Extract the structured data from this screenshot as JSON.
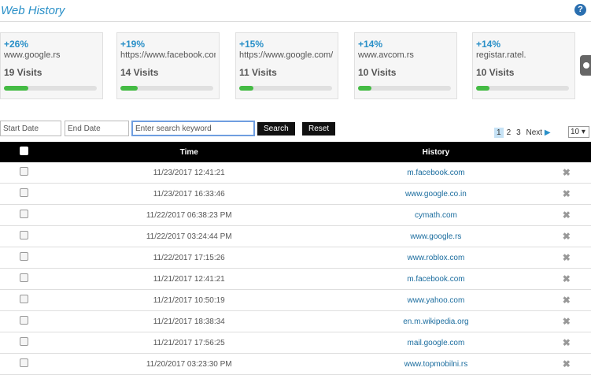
{
  "header": {
    "title": "Web History",
    "help_icon": "?"
  },
  "cards": [
    {
      "pct": "+26%",
      "site": "www.google.rs",
      "visits": "19 Visits",
      "progress": 0.26
    },
    {
      "pct": "+19%",
      "site": "https://www.facebook.com",
      "visits": "14 Visits",
      "progress": 0.19
    },
    {
      "pct": "+15%",
      "site": "https://www.google.com/",
      "visits": "11 Visits",
      "progress": 0.15
    },
    {
      "pct": "+14%",
      "site": "www.avcom.rs",
      "visits": "10 Visits",
      "progress": 0.14
    },
    {
      "pct": "+14%",
      "site": "registar.ratel.",
      "visits": "10 Visits",
      "progress": 0.14
    }
  ],
  "filters": {
    "start_date_placeholder": "Start Date",
    "end_date_placeholder": "End Date",
    "search_placeholder": "Enter search keyword",
    "search_label": "Search",
    "reset_label": "Reset"
  },
  "pagination": {
    "pages": [
      "1",
      "2",
      "3"
    ],
    "active": "1",
    "next_label": "Next",
    "page_size": "10"
  },
  "table": {
    "headers": {
      "time": "Time",
      "history": "History"
    },
    "rows": [
      {
        "time": "11/23/2017 12:41:21",
        "url": "m.facebook.com"
      },
      {
        "time": "11/23/2017 16:33:46",
        "url": "www.google.co.in"
      },
      {
        "time": "11/22/2017 06:38:23 PM",
        "url": "cymath.com"
      },
      {
        "time": "11/22/2017 03:24:44 PM",
        "url": "www.google.rs"
      },
      {
        "time": "11/22/2017 17:15:26",
        "url": "www.roblox.com"
      },
      {
        "time": "11/21/2017 12:41:21",
        "url": "m.facebook.com"
      },
      {
        "time": "11/21/2017 10:50:19",
        "url": "www.yahoo.com"
      },
      {
        "time": "11/21/2017 18:38:34",
        "url": "en.m.wikipedia.org"
      },
      {
        "time": "11/21/2017 17:56:25",
        "url": "mail.google.com"
      },
      {
        "time": "11/20/2017 03:23:30 PM",
        "url": "www.topmobilni.rs"
      }
    ]
  },
  "colors": {
    "accent": "#2a90c8",
    "progress": "#44bb44",
    "table_header": "#000000"
  },
  "icons": {
    "delete": "close-icon",
    "help": "help-icon",
    "next": "next-arrow-icon"
  }
}
